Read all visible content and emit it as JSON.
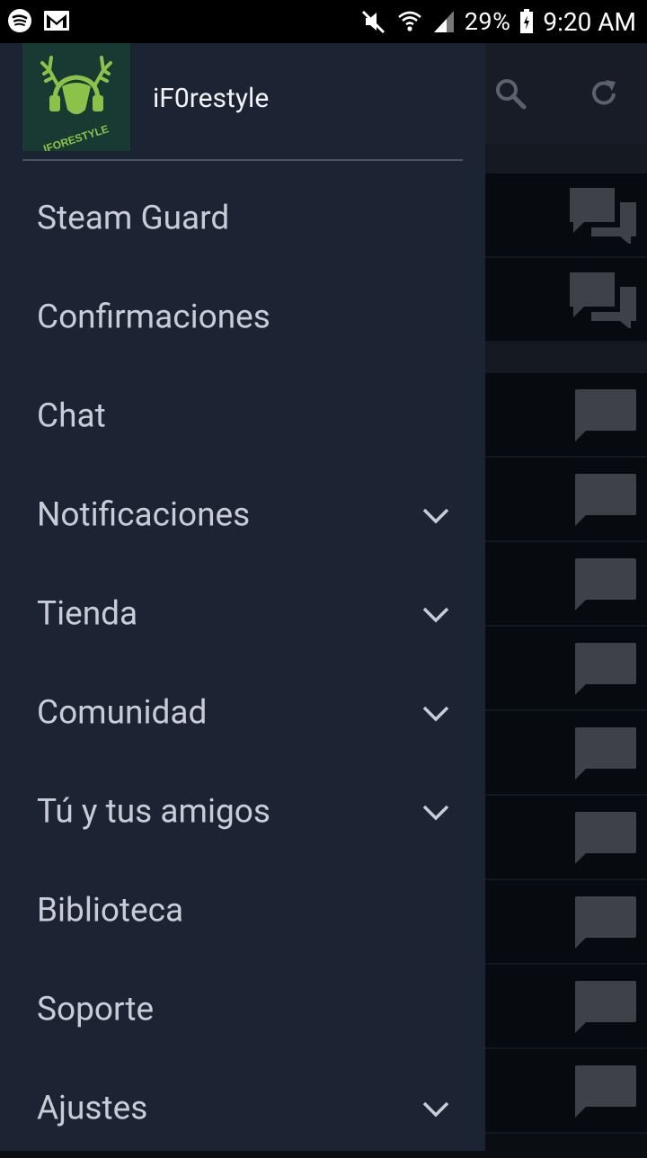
{
  "status_bar": {
    "battery": "29%",
    "time": "9:20 AM",
    "left_icons": [
      "spotify-icon",
      "gmail-icon"
    ],
    "right_icons": [
      "mute-icon",
      "wifi-icon",
      "signal-icon",
      "battery-icon"
    ]
  },
  "drawer": {
    "username": "iF0restyle",
    "avatar_icon": "deer-headphones-logo",
    "avatar_text": "IFORESTYLE",
    "items": [
      {
        "label": "Steam Guard",
        "expandable": false
      },
      {
        "label": "Confirmaciones",
        "expandable": false
      },
      {
        "label": "Chat",
        "expandable": false
      },
      {
        "label": "Notificaciones",
        "expandable": true
      },
      {
        "label": "Tienda",
        "expandable": true
      },
      {
        "label": "Comunidad",
        "expandable": true
      },
      {
        "label": "Tú y tus amigos",
        "expandable": true
      },
      {
        "label": "Biblioteca",
        "expandable": false
      },
      {
        "label": "Soporte",
        "expandable": false
      },
      {
        "label": "Ajustes",
        "expandable": true
      }
    ]
  },
  "background_app": {
    "toolbar_icons": [
      "search-icon",
      "refresh-icon"
    ]
  },
  "colors": {
    "drawer_bg": "#1c2333",
    "menu_text": "#c7ccd6",
    "accent_logo": "#8bc34a"
  }
}
